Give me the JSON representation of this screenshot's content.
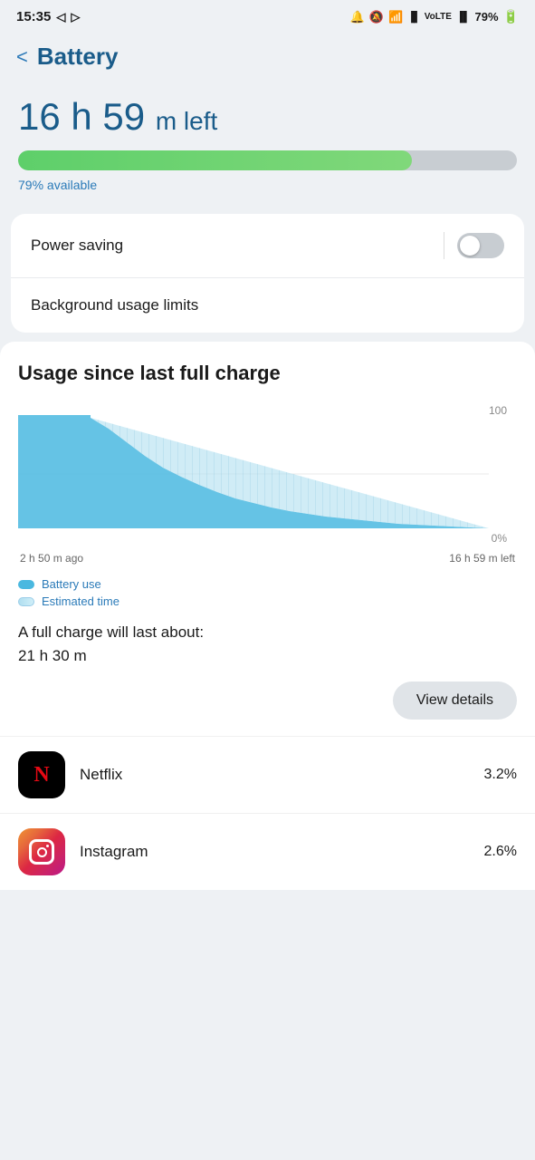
{
  "statusBar": {
    "time": "15:35",
    "battery": "79%",
    "icons": [
      "nav",
      "cast",
      "wifi",
      "signal1",
      "volte",
      "signal2"
    ]
  },
  "header": {
    "backLabel": "<",
    "title": "Battery"
  },
  "batteryTime": {
    "hours": "16",
    "minutes": "59",
    "unit": "m",
    "suffix": "left",
    "hoursUnit": "h"
  },
  "progressBar": {
    "percent": 79,
    "availableText": "79% available"
  },
  "powerSaving": {
    "label": "Power saving",
    "enabled": false
  },
  "backgroundUsage": {
    "label": "Background usage limits"
  },
  "usageSection": {
    "title": "Usage since last full charge",
    "chart": {
      "yMax": "100",
      "yMin": "0%",
      "xLeft": "2 h 50 m ago",
      "xRight": "16 h 59 m left"
    },
    "legend": {
      "item1": "Battery use",
      "item2": "Estimated time"
    },
    "fullChargeText1": "A full charge will last about:",
    "fullChargeText2": "21 h 30 m",
    "viewDetailsBtn": "View details"
  },
  "apps": [
    {
      "name": "Netflix",
      "percent": "3.2%",
      "type": "netflix"
    },
    {
      "name": "Instagram",
      "percent": "2.6%",
      "type": "instagram"
    }
  ]
}
